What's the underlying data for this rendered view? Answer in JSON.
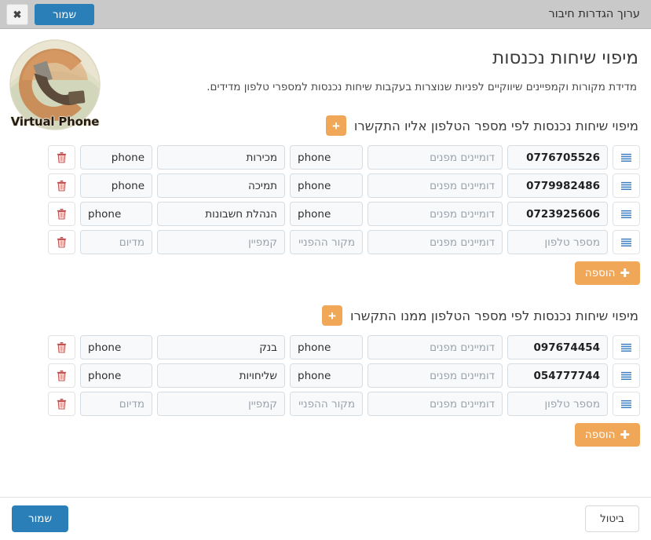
{
  "window": {
    "title": "ערוך הגדרות חיבור",
    "save_label": "שמור",
    "close_label": "✖"
  },
  "logo": {
    "text": "Virtual Phone",
    "circle_color": "#c07b42",
    "ring_color": "#e4e0c6",
    "handset_color": "#5c4b3a"
  },
  "header": {
    "title": "מיפוי שיחות נכנסות",
    "subtitle": "מדידת מקורות וקמפיינים שיווקיים לפניות שנוצרות בעקבות שיחות נכנסות למספרי טלפון מדידים."
  },
  "placeholders": {
    "phone": "מספר טלפון",
    "domains": "דומיינים מפנים",
    "source": "מקור ההפנייה",
    "campaign": "קמפיין",
    "medium": "מדיום"
  },
  "icons": {
    "trash": "trash-icon",
    "list": "list-icon",
    "plus": "+",
    "close": "✖"
  },
  "colors": {
    "accent_orange": "#f0a858",
    "accent_blue": "#2a7fb8",
    "trash_red": "#c0504d",
    "list_blue": "#3a7fc1",
    "topbar_gray": "#c9c9c9"
  },
  "add_button": {
    "label": "הוספה",
    "plus": "✚"
  },
  "sections": [
    {
      "title": "מיפוי שיחות נכנסות לפי מספר הטלפון אליו התקשרו",
      "rows": [
        {
          "phone": "0776705526",
          "domains": "",
          "source": "phone",
          "campaign": "מכירות",
          "medium": "phone",
          "medium_dir": "rtl"
        },
        {
          "phone": "0779982486",
          "domains": "",
          "source": "phone",
          "campaign": "תמיכה",
          "medium": "phone",
          "medium_dir": "rtl"
        },
        {
          "phone": "0723925606",
          "domains": "",
          "source": "phone",
          "campaign": "הנהלת חשבונות",
          "medium": "phone",
          "medium_dir": "ltr"
        },
        {
          "phone": "",
          "domains": "",
          "source": "",
          "campaign": "",
          "medium": "",
          "medium_dir": "rtl"
        }
      ]
    },
    {
      "title": "מיפוי שיחות נכנסות לפי מספר הטלפון ממנו התקשרו",
      "rows": [
        {
          "phone": "097674454",
          "domains": "",
          "source": "phone",
          "campaign": "בנק",
          "medium": "phone",
          "medium_dir": "ltr"
        },
        {
          "phone": "054777744",
          "domains": "",
          "source": "phone",
          "campaign": "שליחויות",
          "medium": "phone",
          "medium_dir": "ltr"
        },
        {
          "phone": "",
          "domains": "",
          "source": "",
          "campaign": "",
          "medium": "",
          "medium_dir": "rtl"
        }
      ]
    }
  ],
  "footer": {
    "save_label": "שמור",
    "cancel_label": "ביטול"
  }
}
